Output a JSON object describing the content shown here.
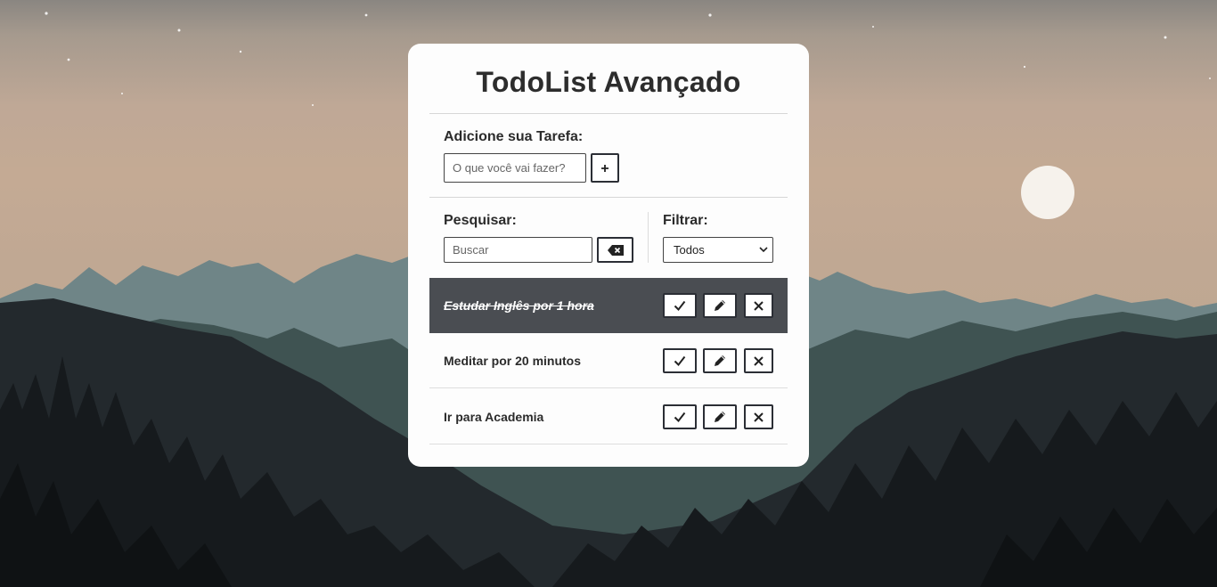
{
  "app": {
    "title": "TodoList Avançado"
  },
  "add": {
    "label": "Adicione sua Tarefa:",
    "placeholder": "O que você vai fazer?",
    "button_icon": "plus-icon"
  },
  "search": {
    "label": "Pesquisar:",
    "placeholder": "Buscar",
    "clear_icon": "backspace-icon"
  },
  "filter": {
    "label": "Filtrar:",
    "selected": "Todos"
  },
  "todos": [
    {
      "text": "Estudar Inglês por 1 hora",
      "done": true
    },
    {
      "text": "Meditar por 20 minutos",
      "done": false
    },
    {
      "text": "Ir para Academia",
      "done": false
    }
  ],
  "icons": {
    "finish": "check-icon",
    "edit": "pencil-icon",
    "remove": "close-icon"
  },
  "colors": {
    "done_row": "#4a4d52",
    "button_border": "#2b2e35",
    "card": "#fdfdfd"
  }
}
